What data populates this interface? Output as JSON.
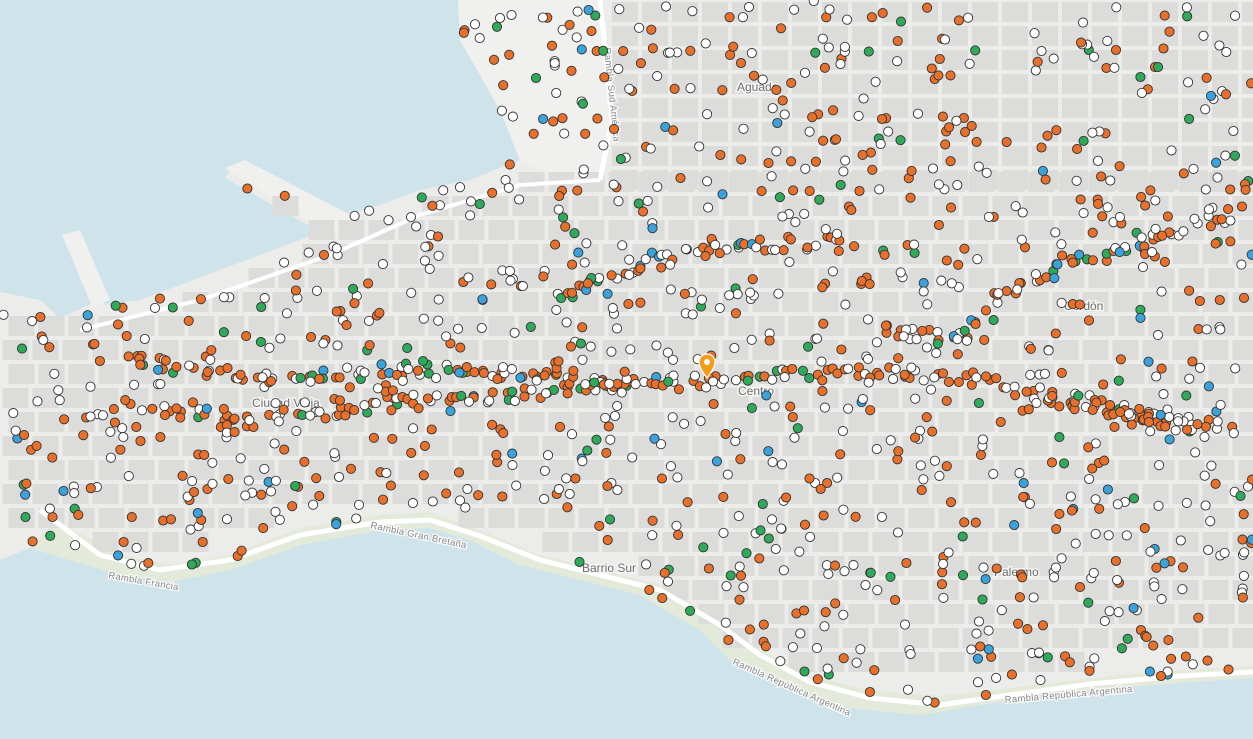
{
  "map": {
    "colors": {
      "water": "#cfe4ea",
      "land": "#ececeb",
      "block": "#dcdcdb",
      "street": "#fbfbfa",
      "park": "#e3ead9",
      "port": "#f0f0ef",
      "marker": "#f39c1a"
    },
    "area_labels": {
      "aguada": "Aguada",
      "ciudad_vieja": "Ciudad Vieja",
      "centro": "Centro",
      "cordon": "Cordón",
      "barrio_sur": "Barrio Sur",
      "palermo": "Palermo"
    },
    "road_labels": {
      "rambla_sud_america": "Rambla Sud América",
      "rambla_gran_bretana": "Rambla Gran Bretaña",
      "rambla_francia": "Rambla Francia",
      "rambla_republica_argentina_1": "Rambla República Argentina",
      "rambla_republica_argentina_2": "Rambla República Argentina"
    },
    "point_categories": [
      {
        "id": "orange",
        "color": "#e8702a"
      },
      {
        "id": "white",
        "color": "#ffffff"
      },
      {
        "id": "green",
        "color": "#2eaa5a"
      },
      {
        "id": "blue",
        "color": "#3ba3dc"
      }
    ],
    "selected_marker_icon": "location-pin-icon"
  }
}
